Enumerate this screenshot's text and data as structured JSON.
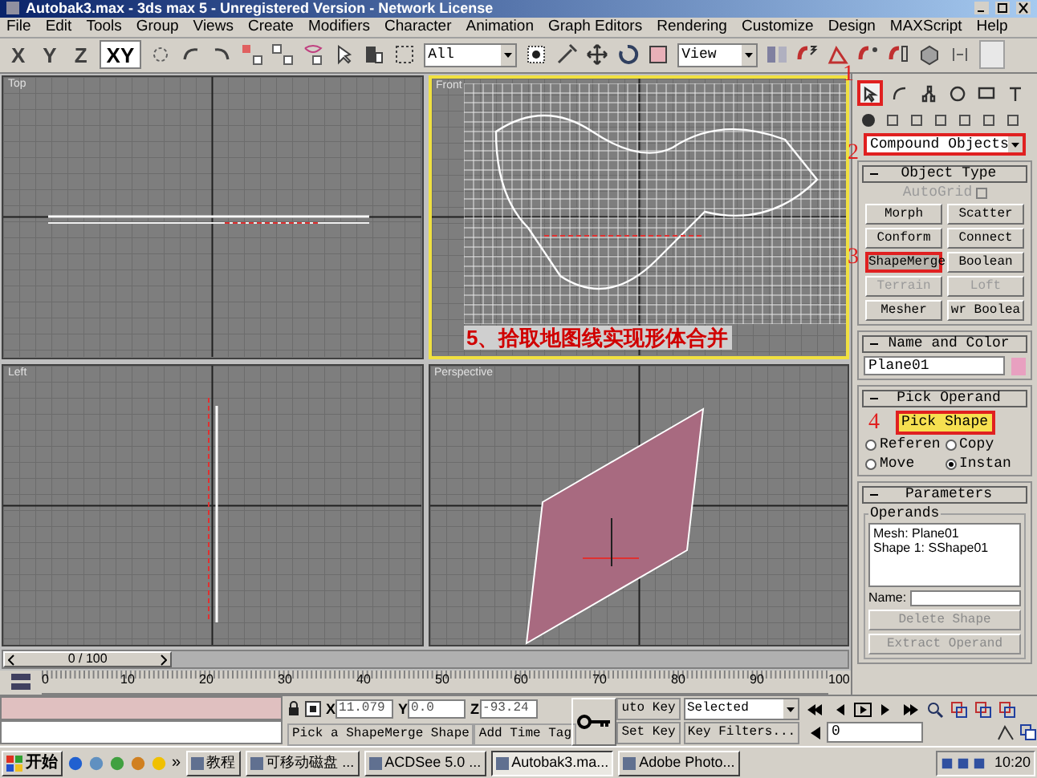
{
  "window": {
    "title": "Autobak3.max - 3ds max 5 - Unregistered Version - Network License"
  },
  "menu": [
    "File",
    "Edit",
    "Tools",
    "Group",
    "Views",
    "Create",
    "Modifiers",
    "Character",
    "Animation",
    "Graph Editors",
    "Rendering",
    "Customize",
    "Design",
    "MAXScript",
    "Help"
  ],
  "toolbar": {
    "axes": [
      {
        "label": "X",
        "selected": false
      },
      {
        "label": "Y",
        "selected": false
      },
      {
        "label": "Z",
        "selected": false
      },
      {
        "label": "XY",
        "selected": true
      }
    ],
    "selection_filter": "All",
    "reference_coord": "View"
  },
  "viewports": [
    {
      "label": "Top",
      "active": false,
      "kind": "top"
    },
    {
      "label": "Front",
      "active": true,
      "kind": "front",
      "caption": "5、拾取地图线实现形体合并"
    },
    {
      "label": "Left",
      "active": false,
      "kind": "left"
    },
    {
      "label": "Perspective",
      "active": false,
      "kind": "perspective"
    }
  ],
  "command_panel": {
    "tabs": [
      {
        "selected": true,
        "callout": "1"
      },
      {
        "selected": false
      },
      {
        "selected": false
      },
      {
        "selected": false
      },
      {
        "selected": false
      },
      {
        "selected": false
      }
    ],
    "category": {
      "value": "Compound Objects",
      "callout": "2"
    },
    "object_type": {
      "title": "Object Type",
      "autogrid": {
        "label": "AutoGrid",
        "checked": false,
        "disabled": true
      },
      "buttons": [
        {
          "label": "Morph",
          "disabled": false,
          "selected": false
        },
        {
          "label": "Scatter",
          "disabled": false,
          "selected": false
        },
        {
          "label": "Conform",
          "disabled": false,
          "selected": false
        },
        {
          "label": "Connect",
          "disabled": false,
          "selected": false
        },
        {
          "label": "ShapeMerge",
          "disabled": false,
          "selected": true,
          "callout": "3"
        },
        {
          "label": "Boolean",
          "disabled": false,
          "selected": false
        },
        {
          "label": "Terrain",
          "disabled": true,
          "selected": false
        },
        {
          "label": "Loft",
          "disabled": true,
          "selected": false
        },
        {
          "label": "Mesher",
          "disabled": false,
          "selected": false
        },
        {
          "label": "wr Boolea",
          "disabled": false,
          "selected": false
        }
      ]
    },
    "name_and_color": {
      "title": "Name and Color",
      "name": "Plane01",
      "color": "#e8a0c0"
    },
    "pick_operand": {
      "title": "Pick Operand",
      "button": {
        "label": "Pick Shape",
        "active": true,
        "callout": "4"
      },
      "options": [
        {
          "label": "Referen",
          "selected": false
        },
        {
          "label": "Copy",
          "selected": false
        },
        {
          "label": "Move",
          "selected": false
        },
        {
          "label": "Instan",
          "selected": true
        }
      ]
    },
    "parameters": {
      "title": "Parameters",
      "group": "Operands",
      "operands": [
        "Mesh: Plane01",
        "Shape 1: SShape01"
      ],
      "name_label": "Name:",
      "buttons": [
        {
          "label": "Delete Shape",
          "disabled": true
        },
        {
          "label": "Extract Operand",
          "disabled": true
        }
      ]
    }
  },
  "timeline": {
    "position": "0 / 100",
    "level": 0,
    "ticks": [
      "0",
      "10",
      "20",
      "30",
      "40",
      "50",
      "60",
      "70",
      "80",
      "90",
      "100"
    ]
  },
  "status": {
    "coords": [
      {
        "axis": "X",
        "value": "11.079"
      },
      {
        "axis": "Y",
        "value": "0.0"
      },
      {
        "axis": "Z",
        "value": "-93.24"
      }
    ],
    "prompt": "Pick a ShapeMerge Shape",
    "time_tag": "Add Time Tag",
    "auto_key": "uto Key",
    "set_key": "Set Key",
    "key_mode": "Selected",
    "key_filters": "Key Filters...",
    "frame": "0"
  },
  "taskbar": {
    "start": "开始",
    "overflow": "»",
    "tasks": [
      {
        "label": "教程",
        "selected": false
      },
      {
        "label": "可移动磁盘 ...",
        "selected": false
      },
      {
        "label": "ACDSee 5.0 ...",
        "selected": false
      },
      {
        "label": "Autobak3.ma...",
        "selected": true
      },
      {
        "label": "Adobe Photo...",
        "selected": false
      }
    ],
    "clock": "10:20"
  }
}
